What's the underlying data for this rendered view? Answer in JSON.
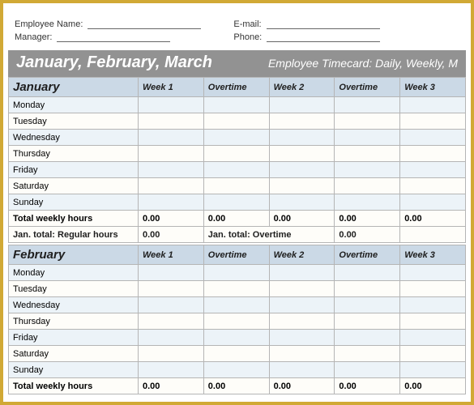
{
  "header": {
    "employee_name_label": "Employee Name:",
    "manager_label": "Manager:",
    "email_label": "E-mail:",
    "phone_label": "Phone:"
  },
  "title_bar": {
    "left": "January, February, March",
    "right": "Employee Timecard: Daily, Weekly, M"
  },
  "columns": [
    "Week 1",
    "Overtime",
    "Week 2",
    "Overtime",
    "Week 3"
  ],
  "days": [
    "Monday",
    "Tuesday",
    "Wednesday",
    "Thursday",
    "Friday",
    "Saturday",
    "Sunday"
  ],
  "labels": {
    "total_weekly": "Total weekly hours"
  },
  "january": {
    "month": "January",
    "totals": [
      "0.00",
      "0.00",
      "0.00",
      "0.00",
      "0.00"
    ],
    "summary": {
      "regular_label": "Jan. total: Regular hours",
      "regular_value": "0.00",
      "overtime_label": "Jan. total: Overtime",
      "overtime_value": "0.00"
    }
  },
  "february": {
    "month": "February",
    "totals": [
      "0.00",
      "0.00",
      "0.00",
      "0.00",
      "0.00"
    ]
  }
}
